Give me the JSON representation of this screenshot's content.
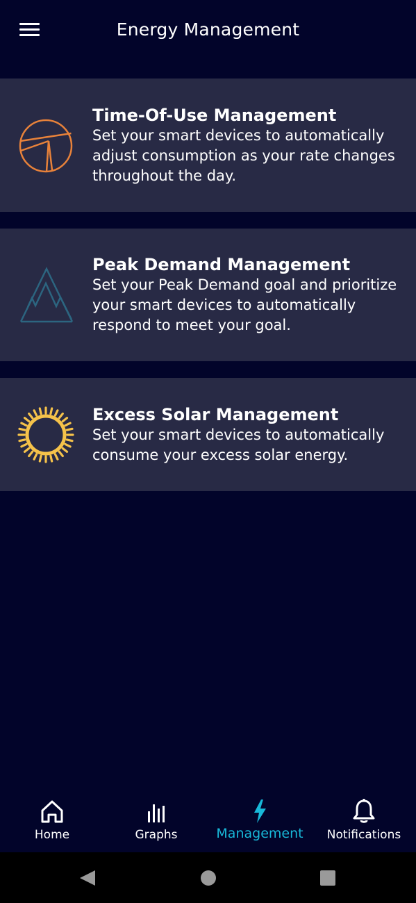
{
  "header": {
    "title": "Energy Management",
    "menu_icon": "hamburger-menu-icon"
  },
  "cards": [
    {
      "title": "Time-Of-Use Management",
      "description": "Set your smart devices to automatically adjust consumption as your rate changes throughout the day.",
      "icon": "time-of-use-clock-icon",
      "icon_color": "#e8823a"
    },
    {
      "title": "Peak Demand Management",
      "description": "Set your Peak Demand goal and prioritize your smart devices to automatically respond to meet your goal.",
      "icon": "mountain-peaks-icon",
      "icon_color": "#2c6580"
    },
    {
      "title": "Excess Solar Management",
      "description": "Set your smart devices to automatically consume your excess solar energy.",
      "icon": "sun-icon",
      "icon_color": "#f5c24a"
    }
  ],
  "bottom_nav": {
    "items": [
      {
        "label": "Home",
        "icon": "home-icon",
        "active": false
      },
      {
        "label": "Graphs",
        "icon": "bar-chart-icon",
        "active": false
      },
      {
        "label": "Management",
        "icon": "lightning-bolt-icon",
        "active": true
      },
      {
        "label": "Notifications",
        "icon": "bell-icon",
        "active": false
      }
    ],
    "active_color": "#18b8d8"
  },
  "colors": {
    "background": "#02042a",
    "card_background": "#282a45",
    "text": "#ffffff"
  }
}
